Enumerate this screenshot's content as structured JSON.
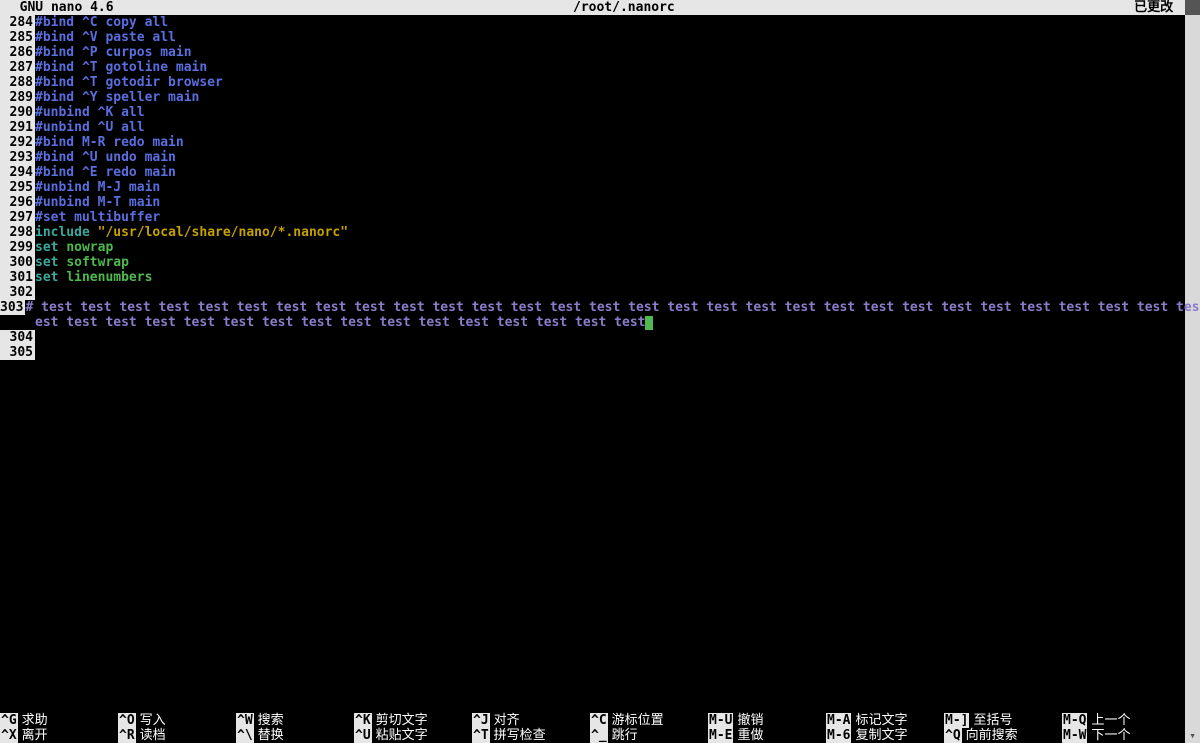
{
  "title": {
    "app": "  GNU nano 4.6",
    "file": "/root/.nanorc",
    "status": "已更改 "
  },
  "colors": {
    "linenum_bg": "#e6e6e6",
    "keyword": "#3aa89b",
    "comment": "#5a6ee0",
    "string": "#c4a000",
    "option": "#4fb84f",
    "testline": "#8b7cc9",
    "cursor": "#4fb84f"
  },
  "lines": [
    {
      "n": "284",
      "spans": [
        {
          "t": "#bind ^C copy all",
          "c": "c-blue"
        }
      ]
    },
    {
      "n": "285",
      "spans": [
        {
          "t": "#bind ^V paste all",
          "c": "c-blue"
        }
      ]
    },
    {
      "n": "286",
      "spans": [
        {
          "t": "#bind ^P curpos main",
          "c": "c-blue"
        }
      ]
    },
    {
      "n": "287",
      "spans": [
        {
          "t": "#bind ^T gotoline main",
          "c": "c-blue"
        }
      ]
    },
    {
      "n": "288",
      "spans": [
        {
          "t": "#bind ^T gotodir browser",
          "c": "c-blue"
        }
      ]
    },
    {
      "n": "289",
      "spans": [
        {
          "t": "#bind ^Y speller main",
          "c": "c-blue"
        }
      ]
    },
    {
      "n": "290",
      "spans": [
        {
          "t": "#unbind ^K all",
          "c": "c-blue"
        }
      ]
    },
    {
      "n": "291",
      "spans": [
        {
          "t": "#unbind ^U all",
          "c": "c-blue"
        }
      ]
    },
    {
      "n": "292",
      "spans": [
        {
          "t": "#bind M-R redo main",
          "c": "c-blue"
        }
      ]
    },
    {
      "n": "293",
      "spans": [
        {
          "t": "#bind ^U undo main",
          "c": "c-blue"
        }
      ]
    },
    {
      "n": "294",
      "spans": [
        {
          "t": "#bind ^E redo main",
          "c": "c-blue"
        }
      ]
    },
    {
      "n": "295",
      "spans": [
        {
          "t": "#unbind M-J main",
          "c": "c-blue"
        }
      ]
    },
    {
      "n": "296",
      "spans": [
        {
          "t": "#unbind M-T main",
          "c": "c-blue"
        }
      ]
    },
    {
      "n": "297",
      "spans": [
        {
          "t": "#set multibuffer",
          "c": "c-blue"
        }
      ]
    },
    {
      "n": "298",
      "spans": [
        {
          "t": "include ",
          "c": "c-teal"
        },
        {
          "t": "\"/usr/local/share/nano/*.nanorc\"",
          "c": "c-yellow"
        }
      ]
    },
    {
      "n": "299",
      "spans": [
        {
          "t": "set ",
          "c": "c-teal"
        },
        {
          "t": "nowrap",
          "c": "c-green"
        }
      ]
    },
    {
      "n": "300",
      "spans": [
        {
          "t": "set ",
          "c": "c-teal"
        },
        {
          "t": "softwrap",
          "c": "c-green"
        }
      ]
    },
    {
      "n": "301",
      "spans": [
        {
          "t": "set ",
          "c": "c-teal"
        },
        {
          "t": "linenumbers",
          "c": "c-green"
        }
      ]
    },
    {
      "n": "302",
      "spans": [
        {
          "t": "",
          "c": ""
        }
      ]
    },
    {
      "n": "303",
      "spans": [
        {
          "t": "# test test test test test test test test test test test test test test test test test test test test test test test test test test test test test test test t",
          "c": "c-purple"
        }
      ]
    },
    {
      "n": "",
      "spans": [
        {
          "t": "est test test test test test test test test test test test test test test test",
          "c": "c-purple"
        }
      ],
      "cursor": true
    },
    {
      "n": "304",
      "spans": [
        {
          "t": "",
          "c": ""
        }
      ]
    },
    {
      "n": "305",
      "spans": [
        {
          "t": "",
          "c": ""
        }
      ]
    }
  ],
  "footer": {
    "row1": [
      {
        "k": "^G",
        "d": "求助"
      },
      {
        "k": "^O",
        "d": "写入"
      },
      {
        "k": "^W",
        "d": "搜索"
      },
      {
        "k": "^K",
        "d": "剪切文字"
      },
      {
        "k": "^J",
        "d": "对齐"
      },
      {
        "k": "^C",
        "d": "游标位置"
      },
      {
        "k": "M-U",
        "d": "撤销"
      },
      {
        "k": "M-A",
        "d": "标记文字"
      },
      {
        "k": "M-]",
        "d": "至括号"
      },
      {
        "k": "M-Q",
        "d": "上一个"
      }
    ],
    "row2": [
      {
        "k": "^X",
        "d": "离开"
      },
      {
        "k": "^R",
        "d": "读档"
      },
      {
        "k": "^\\",
        "d": "替换"
      },
      {
        "k": "^U",
        "d": "粘贴文字"
      },
      {
        "k": "^T",
        "d": "拼写检查"
      },
      {
        "k": "^_",
        "d": "跳行"
      },
      {
        "k": "M-E",
        "d": "重做"
      },
      {
        "k": "M-6",
        "d": "复制文字"
      },
      {
        "k": "^Q",
        "d": "向前搜索"
      },
      {
        "k": "M-W",
        "d": "下一个"
      }
    ]
  }
}
